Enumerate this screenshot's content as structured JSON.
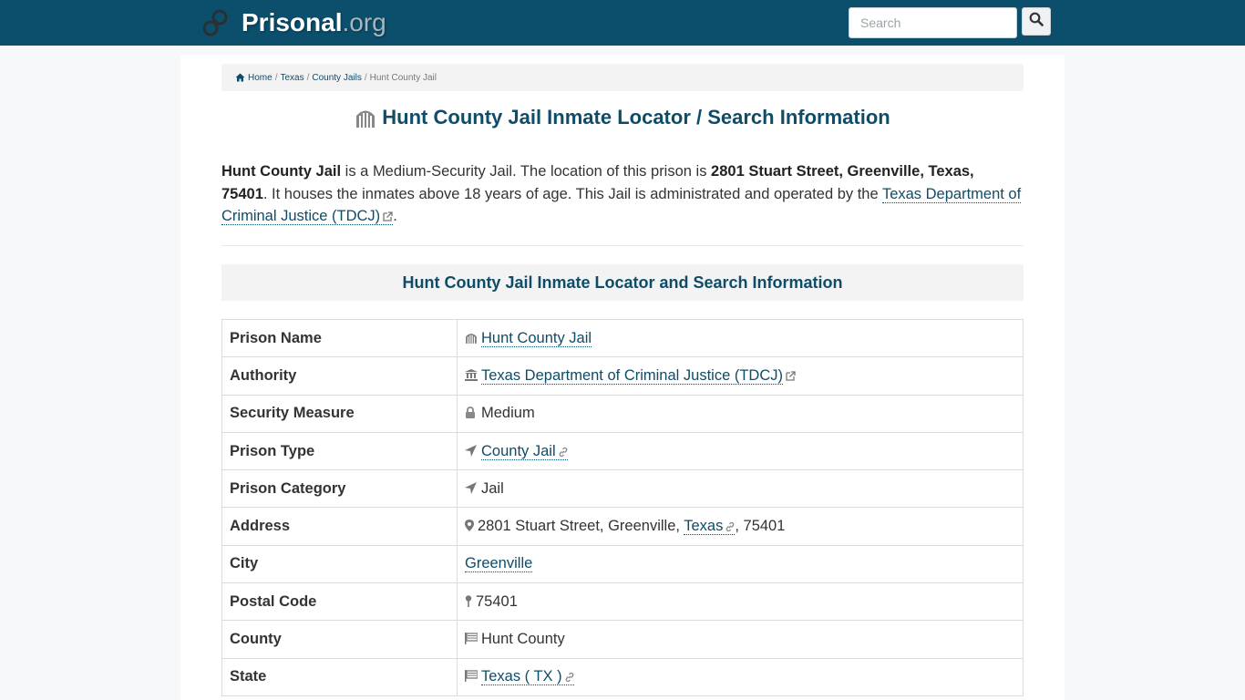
{
  "header": {
    "brand_name": "Prisonal",
    "brand_tld": ".org",
    "search_placeholder": "Search",
    "colors": {
      "bar": "#0b4f6c",
      "link": "#0e4c68"
    }
  },
  "breadcrumb": {
    "home": "Home",
    "state": "Texas",
    "category": "County Jails",
    "current": "Hunt County Jail"
  },
  "page": {
    "title": "Hunt County Jail Inmate Locator / Search Information",
    "intro": {
      "name": "Hunt County Jail",
      "text1": " is a Medium-Security Jail. The location of this prison is ",
      "address": "2801 Stuart Street, Greenville, Texas, 75401",
      "text2": ". It houses the inmates above 18 years of age. This Jail is administrated and operated by the ",
      "authority_link": "Texas Department of Criminal Justice (TDCJ)",
      "text3": "."
    },
    "section_title": "Hunt County Jail Inmate Locator and Search Information"
  },
  "table": {
    "rows": [
      {
        "label": "Prison Name",
        "value": "Hunt County Jail",
        "icon": "prison-icon"
      },
      {
        "label": "Authority",
        "value": "Texas Department of Criminal Justice (TDCJ)",
        "icon": "institution-icon"
      },
      {
        "label": "Security Measure",
        "value": "Medium",
        "icon": "lock-icon"
      },
      {
        "label": "Prison Type",
        "value": "County Jail",
        "icon": "location-arrow-icon"
      },
      {
        "label": "Prison Category",
        "value": "Jail",
        "icon": "location-arrow-icon"
      },
      {
        "label": "Address",
        "value_street": "2801 Stuart Street, Greenville, ",
        "value_state": "Texas",
        "value_zip": ", 75401",
        "icon": "map-marker-icon"
      },
      {
        "label": "City",
        "value": "Greenville"
      },
      {
        "label": "Postal Code",
        "value": "75401",
        "icon": "map-pin-icon"
      },
      {
        "label": "County",
        "value": "Hunt County",
        "icon": "flag-icon"
      },
      {
        "label": "State",
        "value": "Texas ( TX )",
        "icon": "flag-icon"
      }
    ]
  }
}
